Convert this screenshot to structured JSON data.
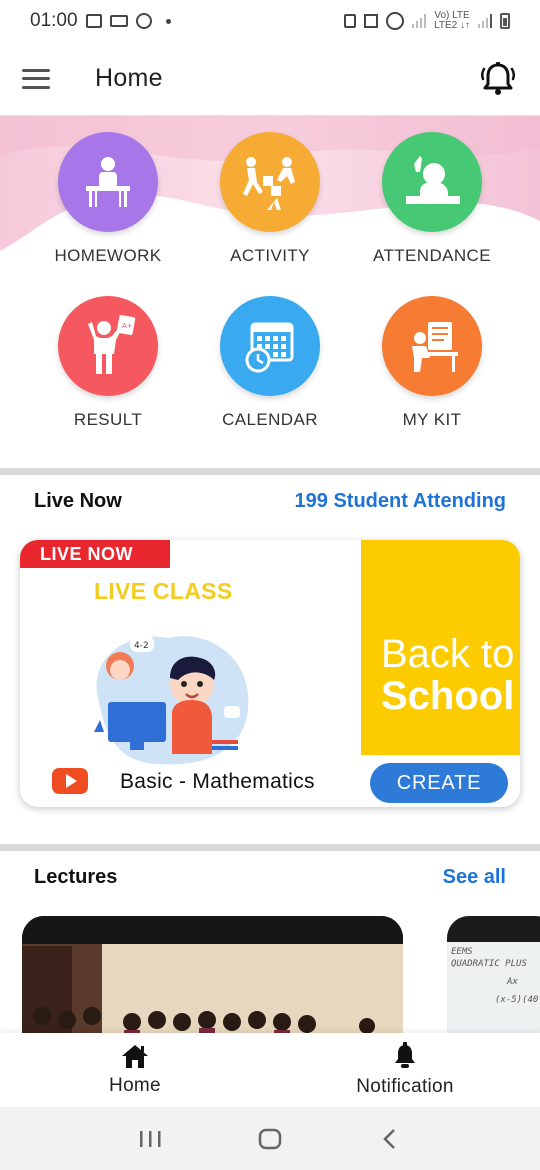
{
  "status_bar": {
    "time": "01:00",
    "network_label_1": "Vo) LTE",
    "network_label_2": "LTE2 ↓↑"
  },
  "app_bar": {
    "title": "Home",
    "menu_icon": "hamburger-menu-icon",
    "notification_icon": "bell-icon"
  },
  "grid": {
    "items": [
      {
        "label": "HOMEWORK",
        "color": "#a777ea",
        "icon": "homework-icon"
      },
      {
        "label": "ACTIVITY",
        "color": "#f6ac34",
        "icon": "activity-icon"
      },
      {
        "label": "ATTENDANCE",
        "color": "#47c874",
        "icon": "attendance-icon"
      },
      {
        "label": "RESULT",
        "color": "#f6585f",
        "icon": "result-icon"
      },
      {
        "label": "CALENDAR",
        "color": "#3aaaf0",
        "icon": "calendar-icon"
      },
      {
        "label": "MY KIT",
        "color": "#f57c32",
        "icon": "my-kit-icon"
      }
    ]
  },
  "live": {
    "title": "Live Now",
    "attending": "199 Student Attending",
    "badge": "LIVE NOW",
    "class_title": "LIVE CLASS",
    "subject": "Basic - Mathematics",
    "banner_line1": "Back to",
    "banner_line2": "School",
    "create_label": "CREATE"
  },
  "lectures": {
    "title": "Lectures",
    "see_all": "See all",
    "card_2_lines": [
      "EEMS",
      "QUADRATIC PLUS",
      "Ax",
      "(x-5)(40"
    ]
  },
  "bottom_nav": {
    "items": [
      {
        "label": "Home",
        "icon": "home-icon"
      },
      {
        "label": "Notification",
        "icon": "bell-icon"
      }
    ]
  },
  "colors": {
    "accent_blue": "#1e73d8",
    "live_red": "#e8262e",
    "banner_yellow": "#fccc00"
  }
}
